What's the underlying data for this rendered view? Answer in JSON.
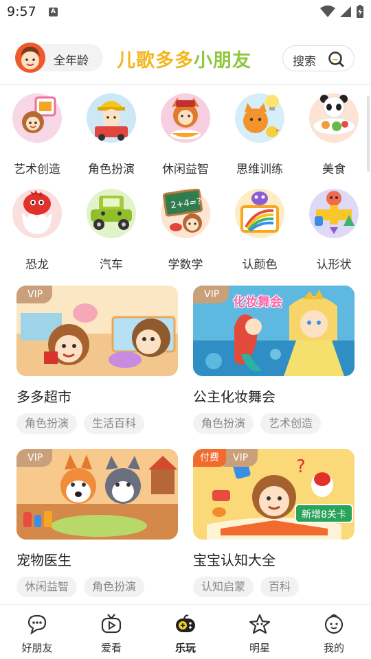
{
  "status_bar": {
    "time": "9:57",
    "notification_letter": "A"
  },
  "header": {
    "age_label": "全年龄",
    "app_title_part1": "儿歌多多",
    "app_title_part2": "小朋友",
    "search_label": "搜索"
  },
  "categories": [
    {
      "label": "艺术创造",
      "icon": "art-icon",
      "color": "#f8d7e6"
    },
    {
      "label": "角色扮演",
      "icon": "role-play-icon",
      "color": "#cde7f7"
    },
    {
      "label": "休闲益智",
      "icon": "puzzle-icon",
      "color": "#f7cfe0"
    },
    {
      "label": "思维训练",
      "icon": "thinking-icon",
      "color": "#d5eef9"
    },
    {
      "label": "美食",
      "icon": "food-icon",
      "color": "#fde3d3"
    },
    {
      "label": "恐龙",
      "icon": "dinosaur-icon",
      "color": "#fbdede"
    },
    {
      "label": "汽车",
      "icon": "car-icon",
      "color": "#e0f3c9"
    },
    {
      "label": "学数学",
      "icon": "math-icon",
      "color": "#fce5d2"
    },
    {
      "label": "认颜色",
      "icon": "color-icon",
      "color": "#fdecc4"
    },
    {
      "label": "认形状",
      "icon": "shape-icon",
      "color": "#ded9f7"
    }
  ],
  "games": [
    {
      "title": "多多超市",
      "tags": [
        "角色扮演",
        "生活百科"
      ],
      "vip": "VIP",
      "paid": "",
      "bg": "#f6d9a6"
    },
    {
      "title": "公主化妆舞会",
      "tags": [
        "角色扮演",
        "艺术创造"
      ],
      "vip": "VIP",
      "paid": "",
      "bg": "#6fc7e8",
      "banner": "化妆舞会"
    },
    {
      "title": "宠物医生",
      "tags": [
        "休闲益智",
        "角色扮演"
      ],
      "vip": "VIP",
      "paid": "",
      "bg": "#f2b779"
    },
    {
      "title": "宝宝认知大全",
      "tags": [
        "认知启蒙",
        "百科"
      ],
      "vip": "VIP",
      "paid": "付费",
      "bg": "#fbd46a",
      "banner": "新增8关卡"
    }
  ],
  "bottom_nav": [
    {
      "label": "好朋友",
      "icon": "chat-icon",
      "active": false
    },
    {
      "label": "爱看",
      "icon": "tv-icon",
      "active": false
    },
    {
      "label": "乐玩",
      "icon": "gamepad-icon",
      "active": true
    },
    {
      "label": "明星",
      "icon": "star-icon",
      "active": false
    },
    {
      "label": "我的",
      "icon": "face-icon",
      "active": false
    }
  ],
  "colors": {
    "title_yellow": "#f3b61f",
    "title_green": "#8fc63d",
    "vip": "#c9a07a",
    "paid": "#f26a2e"
  }
}
